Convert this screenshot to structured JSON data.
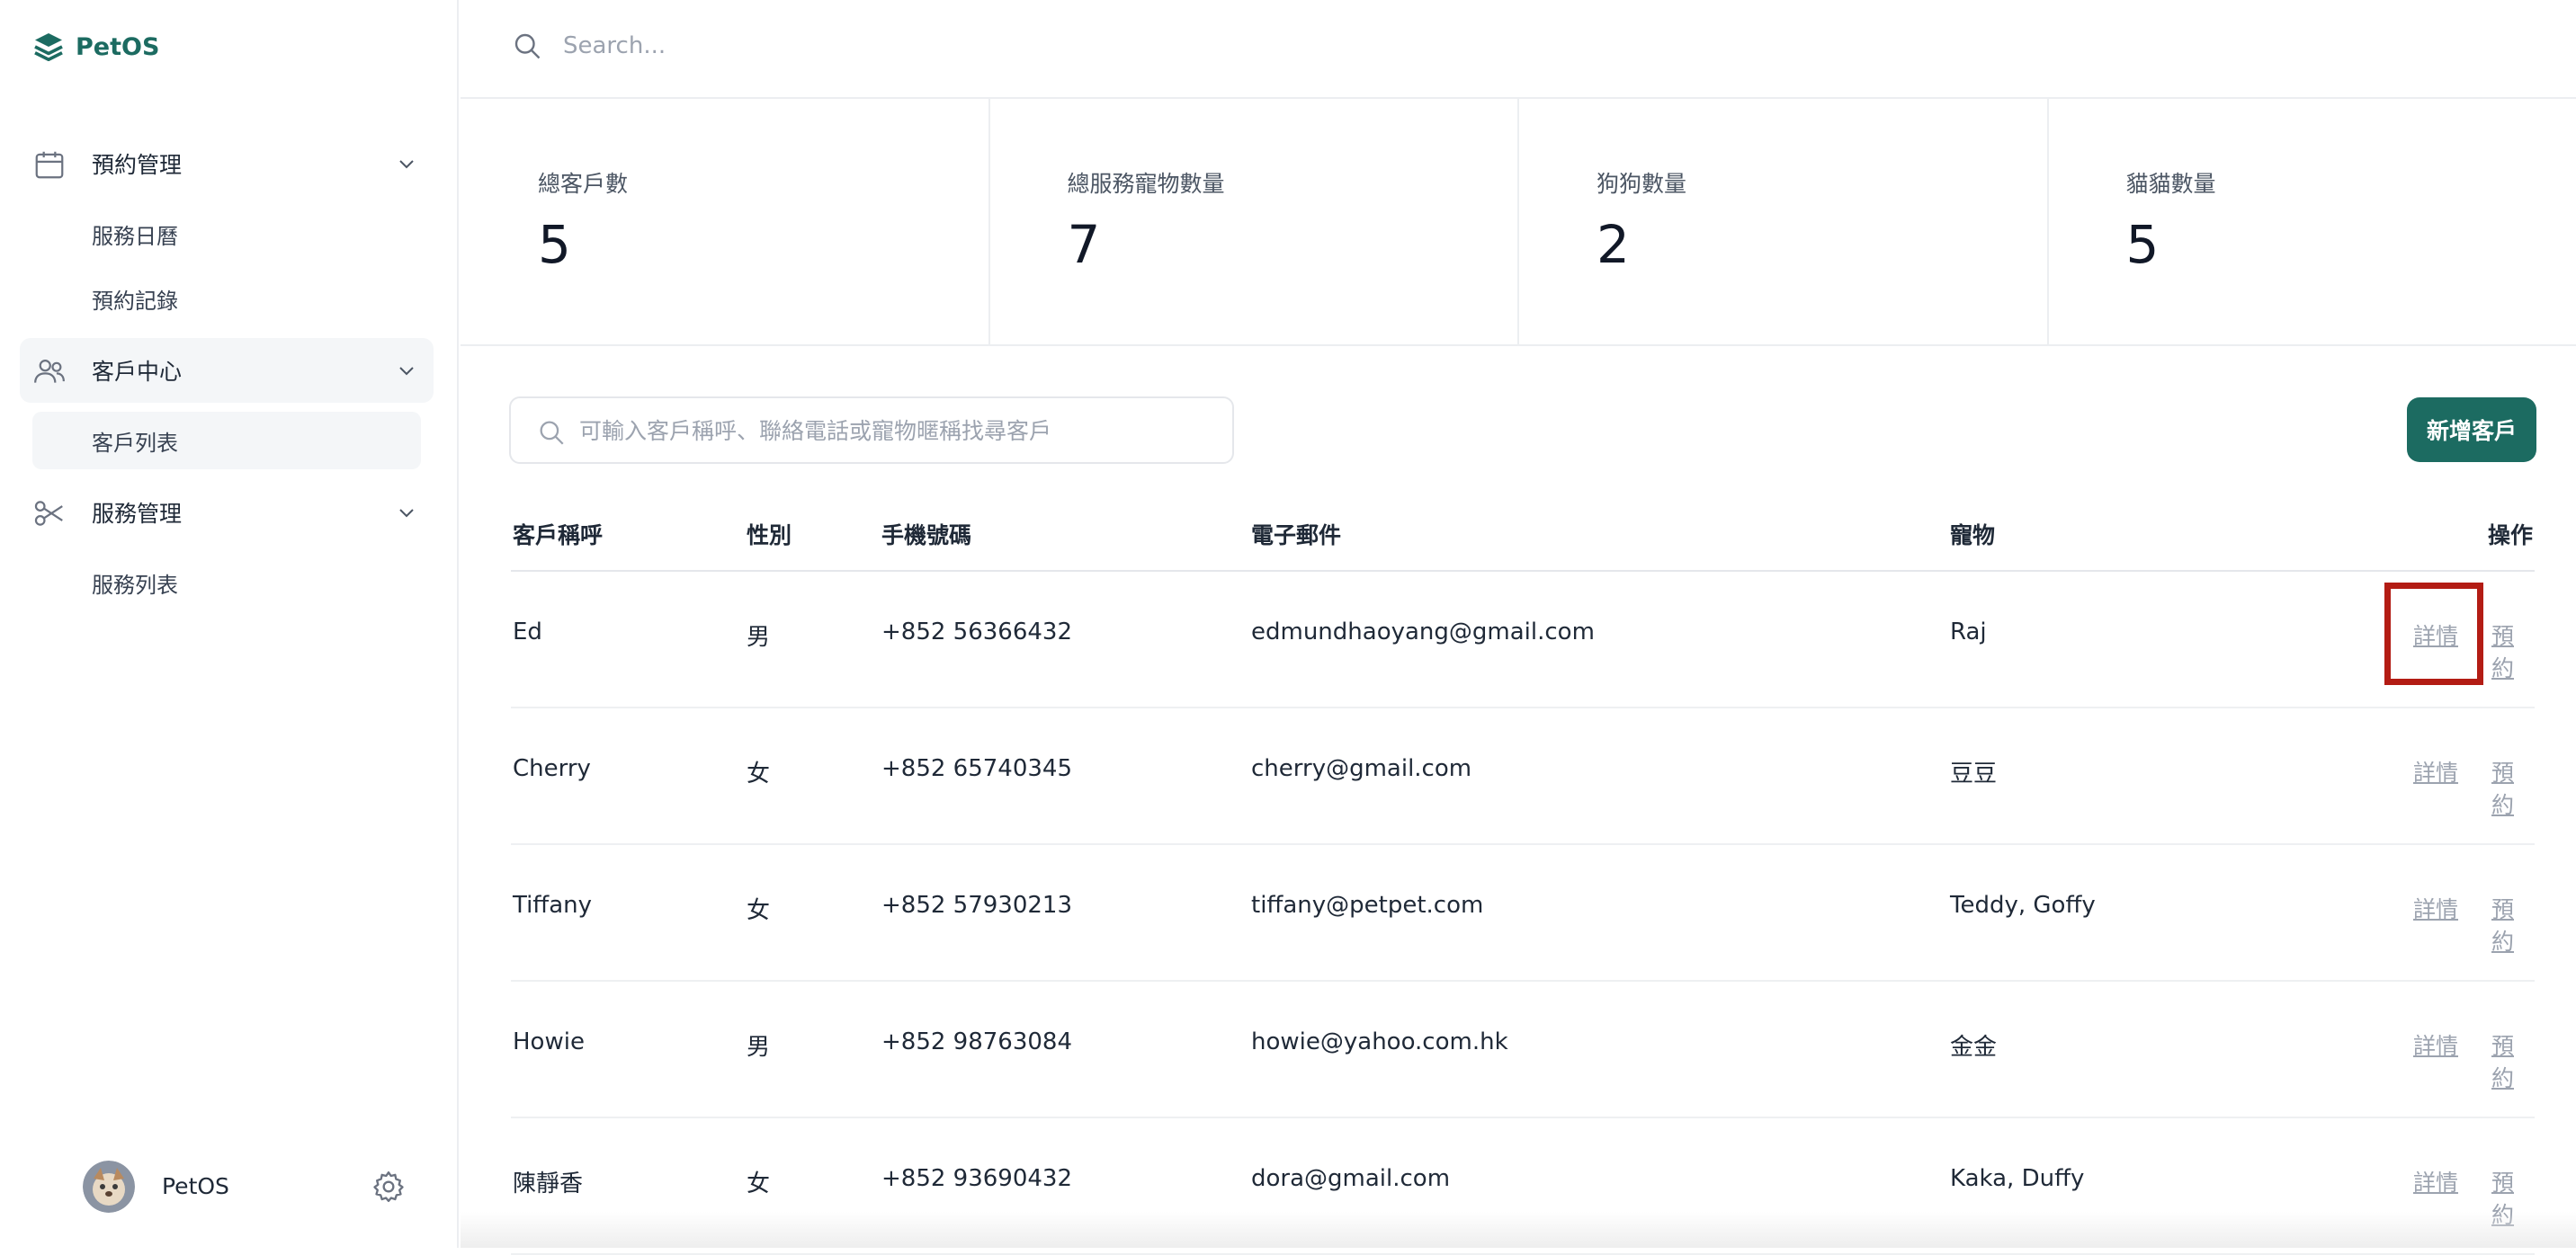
{
  "app": {
    "name": "PetOS"
  },
  "sidebar": {
    "groups": [
      {
        "label": "預約管理",
        "icon": "calendar-icon",
        "items": [
          {
            "label": "服務日曆"
          },
          {
            "label": "預約記錄"
          }
        ]
      },
      {
        "label": "客戶中心",
        "icon": "users-icon",
        "items": [
          {
            "label": "客戶列表"
          }
        ]
      },
      {
        "label": "服務管理",
        "icon": "scissors-icon",
        "items": [
          {
            "label": "服務列表"
          }
        ]
      }
    ],
    "user": {
      "name": "PetOS"
    }
  },
  "topbar": {
    "search_placeholder": "Search..."
  },
  "stats": [
    {
      "label": "總客戶數",
      "value": "5"
    },
    {
      "label": "總服務寵物數量",
      "value": "7"
    },
    {
      "label": "狗狗數量",
      "value": "2"
    },
    {
      "label": "貓貓數量",
      "value": "5"
    }
  ],
  "filter": {
    "placeholder": "可輸入客戶稱呼、聯絡電話或寵物暱稱找尋客戶"
  },
  "add_button": "新增客戶",
  "table": {
    "headers": {
      "name": "客戶稱呼",
      "gender": "性別",
      "phone": "手機號碼",
      "email": "電子郵件",
      "pet": "寵物",
      "action": "操作"
    },
    "action_labels": {
      "detail": "詳情",
      "book": "預約"
    },
    "rows": [
      {
        "name": "Ed",
        "gender": "男",
        "phone": "+852 56366432",
        "email": "edmundhaoyang@gmail.com",
        "pet": "Raj"
      },
      {
        "name": "Cherry",
        "gender": "女",
        "phone": "+852 65740345",
        "email": "cherry@gmail.com",
        "pet": "豆豆"
      },
      {
        "name": "Tiffany",
        "gender": "女",
        "phone": "+852 57930213",
        "email": "tiffany@petpet.com",
        "pet": "Teddy, Goffy"
      },
      {
        "name": "Howie",
        "gender": "男",
        "phone": "+852 98763084",
        "email": "howie@yahoo.com.hk",
        "pet": "金金"
      },
      {
        "name": "陳靜香",
        "gender": "女",
        "phone": "+852 93690432",
        "email": "dora@gmail.com",
        "pet": "Kaka, Duffy"
      }
    ]
  },
  "colors": {
    "brand": "#1c6b61",
    "highlight": "#b31c14",
    "muted_link": "#9ca3af"
  }
}
